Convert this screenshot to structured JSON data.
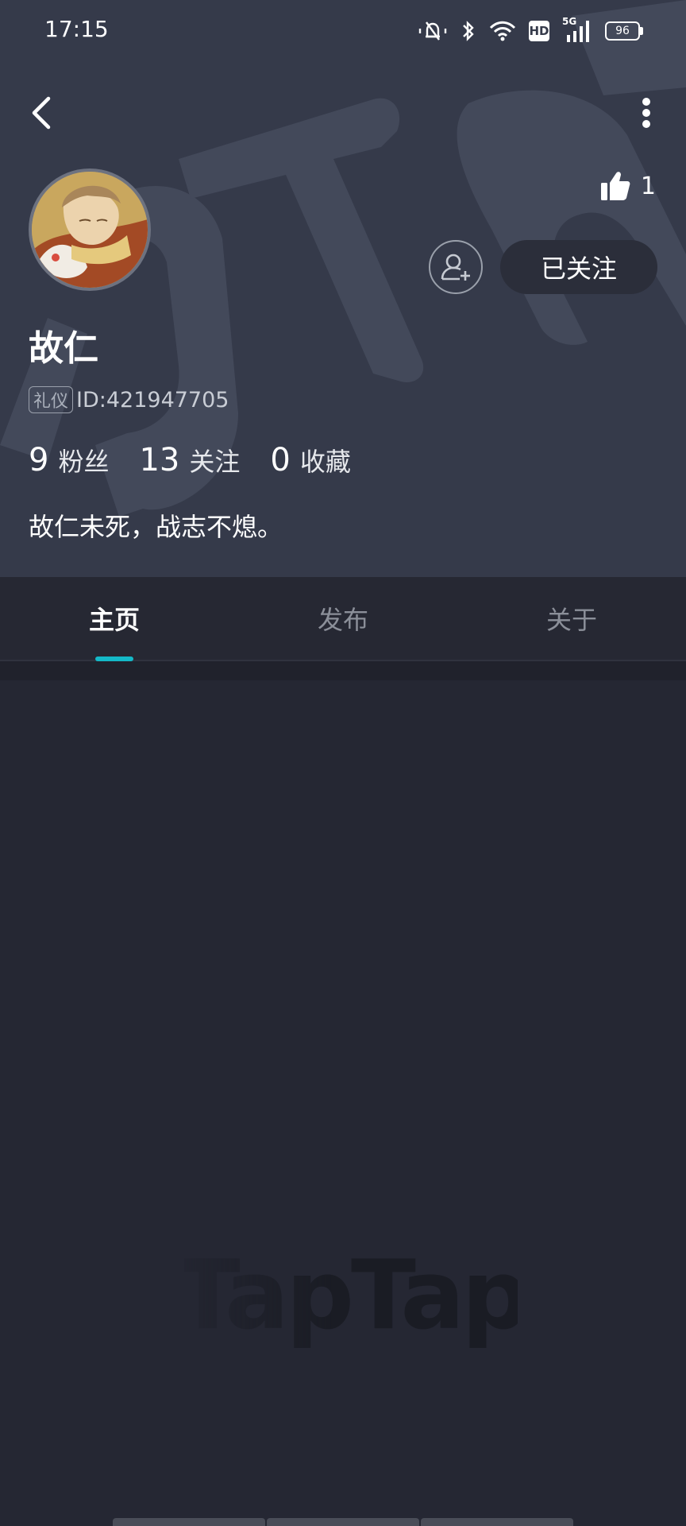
{
  "status_bar": {
    "time": "17:15",
    "network": "5G",
    "hd": "HD",
    "battery": "96"
  },
  "profile": {
    "likes": "1",
    "follow_label": "已关注",
    "name": "故仁",
    "badge": "礼仪",
    "id_text": "ID:421947705",
    "stats": [
      {
        "num": "9",
        "label": "粉丝"
      },
      {
        "num": "13",
        "label": "关注"
      },
      {
        "num": "0",
        "label": "收藏"
      }
    ],
    "bio": "故仁未死，战志不熄。"
  },
  "tabs": [
    {
      "label": "主页",
      "active": true
    },
    {
      "label": "发布",
      "active": false
    },
    {
      "label": "关于",
      "active": false
    }
  ],
  "empty_state": {
    "logo_text": "TapTap"
  },
  "colors": {
    "accent": "#14b9c8",
    "header_bg": "#353a4a",
    "page_bg": "#252733"
  }
}
